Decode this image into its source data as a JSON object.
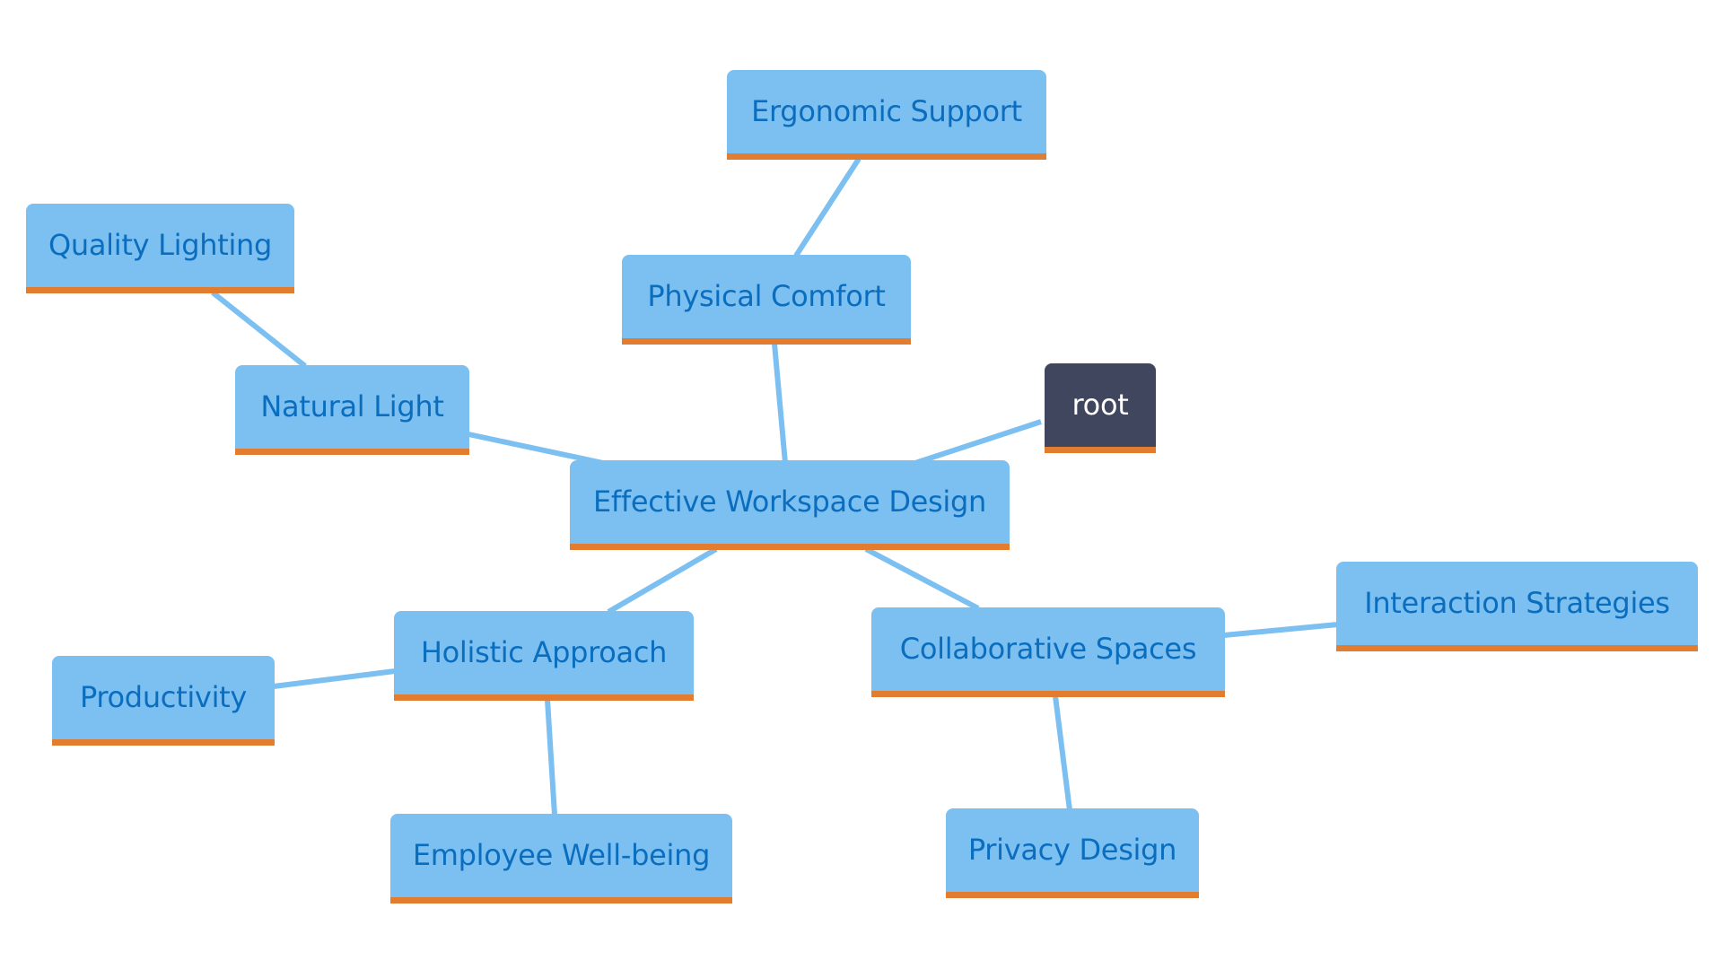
{
  "diagram": {
    "type": "mindmap",
    "colors": {
      "node_fill": "#7cbff1",
      "node_text": "#0a6dbd",
      "node_underline": "#e27d2f",
      "root_fill": "#41465f",
      "root_text": "#ffffff",
      "edge": "#7cbff1"
    },
    "nodes": {
      "root": "root",
      "center": "Effective Workspace Design",
      "physical_comfort": "Physical Comfort",
      "ergonomic_support": "Ergonomic Support",
      "natural_light": "Natural Light",
      "quality_lighting": "Quality Lighting",
      "holistic_approach": "Holistic Approach",
      "productivity": "Productivity",
      "employee_wellbeing": "Employee Well-being",
      "collaborative_spaces": "Collaborative Spaces",
      "interaction_strategies": "Interaction Strategies",
      "privacy_design": "Privacy Design"
    },
    "edges": [
      [
        "root",
        "center"
      ],
      [
        "center",
        "physical_comfort"
      ],
      [
        "physical_comfort",
        "ergonomic_support"
      ],
      [
        "center",
        "natural_light"
      ],
      [
        "natural_light",
        "quality_lighting"
      ],
      [
        "center",
        "holistic_approach"
      ],
      [
        "holistic_approach",
        "productivity"
      ],
      [
        "holistic_approach",
        "employee_wellbeing"
      ],
      [
        "center",
        "collaborative_spaces"
      ],
      [
        "collaborative_spaces",
        "interaction_strategies"
      ],
      [
        "collaborative_spaces",
        "privacy_design"
      ]
    ]
  }
}
